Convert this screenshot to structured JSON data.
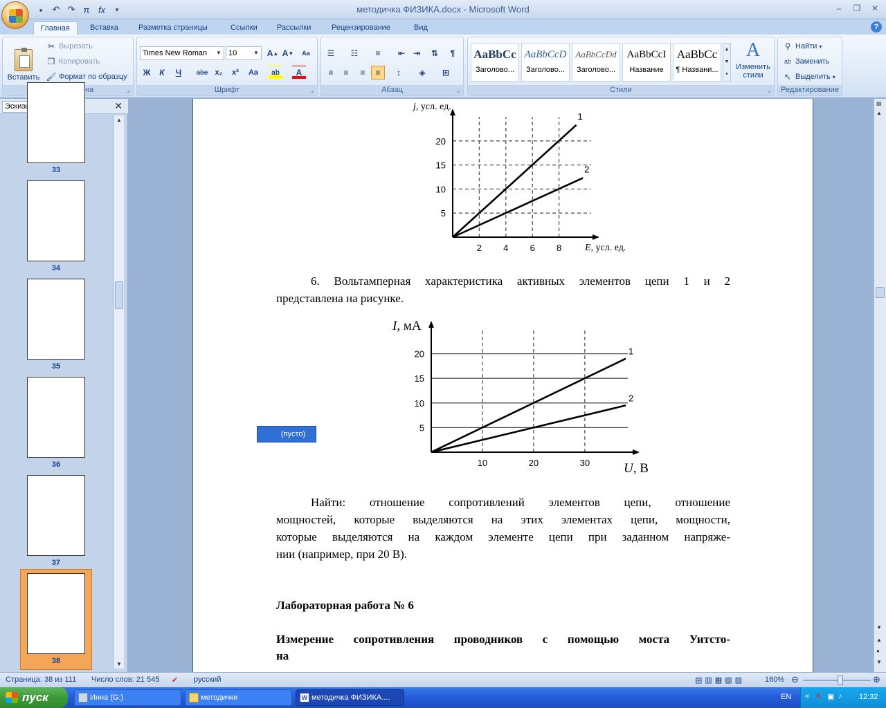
{
  "window": {
    "title": "методичка ФИЗИКА.docx - Microsoft Word",
    "qat_icons": [
      "save-icon",
      "undo-icon",
      "redo-icon",
      "pi-icon",
      "fx-icon",
      "customize-icon"
    ]
  },
  "tabs": [
    "Главная",
    "Вставка",
    "Разметка страницы",
    "Ссылки",
    "Рассылки",
    "Рецензирование",
    "Вид"
  ],
  "active_tab": "Главная",
  "ribbon": {
    "clipboard": {
      "label": "Буфер обмена",
      "paste": "Вставить",
      "cut": "Вырезать",
      "copy": "Копировать",
      "format_painter": "Формат по образцу"
    },
    "font": {
      "label": "Шрифт",
      "font_name": "Times New Roman",
      "font_size": "10",
      "buttons": [
        "Ж",
        "К",
        "Ч",
        "abe",
        "x₂",
        "x²",
        "Aa"
      ]
    },
    "paragraph": {
      "label": "Абзац"
    },
    "styles": {
      "label": "Стили",
      "items": [
        {
          "sample": "AaBbCc",
          "name": "Заголово..."
        },
        {
          "sample": "AaBbCcD",
          "name": "Заголово..."
        },
        {
          "sample": "AaBbCcDd",
          "name": "Заголово..."
        },
        {
          "sample": "AaBbCcI",
          "name": "Название"
        },
        {
          "sample": "AaBbCc",
          "name": "¶ Названи..."
        }
      ],
      "change_styles": "Изменить стили"
    },
    "editing": {
      "label": "Редактирование",
      "find": "Найти",
      "replace": "Заменить",
      "select": "Выделить"
    }
  },
  "thumbnails": {
    "select_value": "Эскизы",
    "pages": [
      "33",
      "34",
      "35",
      "36",
      "37",
      "38"
    ],
    "active_page": "38"
  },
  "document": {
    "para6_line1": "6. Вольтамперная характеристика активных элементов цепи 1 и 2",
    "para6_line2": "представлена на рисунке.",
    "placeholder": "(пусто)",
    "find_line1": "Найти: отношение сопротивлений элементов цепи, отношение",
    "find_line2": "мощностей, которые выделяются на этих элементах цепи, мощности,",
    "find_line3": "которые выделяются на каждом элементе цепи при заданном напряже-",
    "find_line4": "нии (например,  при 20 В).",
    "lab_title": "Лабораторная работа № 6",
    "lab_sub_line1": "Измерение сопротивления проводников с помощью моста Уитсто-",
    "lab_sub_line2": "на"
  },
  "chart_data": [
    {
      "type": "line",
      "xlabel": "E, усл. ед.",
      "ylabel": "j, усл. ед.",
      "xticks": [
        2,
        4,
        6,
        8
      ],
      "yticks": [
        5,
        10,
        15,
        20
      ],
      "xlim": [
        0,
        10
      ],
      "ylim": [
        0,
        25
      ],
      "grid": true,
      "series": [
        {
          "name": "1",
          "x": [
            0,
            9.3
          ],
          "y": [
            0,
            23.3
          ]
        },
        {
          "name": "2",
          "x": [
            0,
            9.8
          ],
          "y": [
            0,
            12.3
          ]
        }
      ]
    },
    {
      "type": "line",
      "xlabel": "U, В",
      "ylabel": "I, мА",
      "xticks": [
        10,
        20,
        30
      ],
      "yticks": [
        5,
        10,
        15,
        20
      ],
      "xlim": [
        0,
        38
      ],
      "ylim": [
        0,
        25
      ],
      "grid": true,
      "series": [
        {
          "name": "1",
          "x": [
            0,
            38
          ],
          "y": [
            0,
            19
          ]
        },
        {
          "name": "2",
          "x": [
            0,
            38
          ],
          "y": [
            0,
            9.5
          ]
        }
      ]
    }
  ],
  "status": {
    "page": "Страница: 38 из 111",
    "words": "Число слов: 21 545",
    "language": "русский",
    "zoom": "160%"
  },
  "taskbar": {
    "start": "пуск",
    "tasks": [
      "Инна (G:)",
      "методички",
      "методичка ФИЗИКА...."
    ],
    "lang": "EN",
    "clock": "12:32"
  }
}
